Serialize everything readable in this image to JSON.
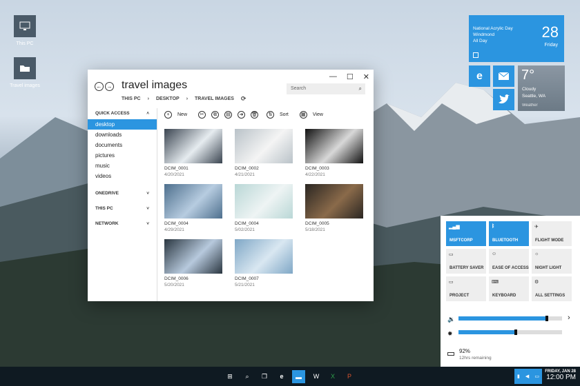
{
  "desktop": {
    "icons": [
      {
        "label": "This PC",
        "icon": "computer-icon"
      },
      {
        "label": "Travel images",
        "icon": "folder-icon"
      }
    ]
  },
  "tiles": {
    "calendar": {
      "line1": "National Acrylic Day",
      "line2": "Windmond",
      "line3": "All Day",
      "date": "28",
      "weekday": "Friday"
    },
    "weather": {
      "temp": "7°",
      "condition": "Cloudy",
      "location": "Seattle, WA",
      "app": "Weather"
    },
    "icons": [
      "edge-icon",
      "mail-icon",
      "twitter-icon",
      "calendar-icon"
    ]
  },
  "explorer": {
    "title": "travel images",
    "breadcrumb": [
      "THIS PC",
      "DESKTOP",
      "TRAVEL IMAGES"
    ],
    "search_placeholder": "Search",
    "sidebar": {
      "quick_access": "QUICK ACCESS",
      "items": [
        "desktop",
        "downloads",
        "documents",
        "pictures",
        "music",
        "videos"
      ],
      "sections": [
        "ONEDRIVE",
        "THIS PC",
        "NETWORK"
      ]
    },
    "toolbar": {
      "new": "New",
      "sort": "Sort",
      "view": "View"
    },
    "files": [
      {
        "name": "DCIM_0001",
        "date": "4/20/2021",
        "colors": [
          "#3a4450",
          "#e6ecf0"
        ]
      },
      {
        "name": "DCIM_0002",
        "date": "4/21/2021",
        "colors": [
          "#b9c2c8",
          "#f4f4f4"
        ]
      },
      {
        "name": "DCIM_0003",
        "date": "4/22/2021",
        "colors": [
          "#111111",
          "#d8d8d8"
        ]
      },
      {
        "name": "DCIM_0004",
        "date": "4/29/2021",
        "colors": [
          "#4d6f8d",
          "#b7cce0"
        ]
      },
      {
        "name": "DCIM_0004",
        "date": "5/02/2021",
        "colors": [
          "#b9d7d6",
          "#eef4f4"
        ]
      },
      {
        "name": "DCIM_0005",
        "date": "5/18/2021",
        "colors": [
          "#2a2622",
          "#8a6a4a"
        ]
      },
      {
        "name": "DCIM_0006",
        "date": "5/20/2021",
        "colors": [
          "#2a3640",
          "#b7c9dd"
        ]
      },
      {
        "name": "DCIM_0007",
        "date": "5/21/2021",
        "colors": [
          "#7fa7c6",
          "#d9e7f1"
        ]
      }
    ]
  },
  "action_center": {
    "tiles": [
      {
        "label": "MSFTCORP",
        "icon": "wifi-icon",
        "on": true
      },
      {
        "label": "BLUETOOTH",
        "icon": "bluetooth-icon",
        "on": true
      },
      {
        "label": "FLIGHT MODE",
        "icon": "airplane-icon",
        "on": false
      },
      {
        "label": "BATTERY SAVER",
        "icon": "battery-icon",
        "on": false
      },
      {
        "label": "EASE OF ACCESS",
        "icon": "ease-icon",
        "on": false
      },
      {
        "label": "NIGHT LIGHT",
        "icon": "sun-icon",
        "on": false
      },
      {
        "label": "PROJECT",
        "icon": "monitor-icon",
        "on": false
      },
      {
        "label": "KEYBOARD",
        "icon": "keyboard-icon",
        "on": false
      },
      {
        "label": "ALL SETTINGS",
        "icon": "gear-icon",
        "on": false
      }
    ],
    "volume_level": 0.85,
    "brightness_level": 0.55,
    "battery_percent": "92%",
    "battery_remaining": "12hrs remaining"
  },
  "taskbar": {
    "clock_date": "FRIDAY, JAN 28",
    "clock_time": "12:00 PM"
  },
  "colors": {
    "accent": "#2b95e0",
    "taskbar": "#0f1a22"
  }
}
